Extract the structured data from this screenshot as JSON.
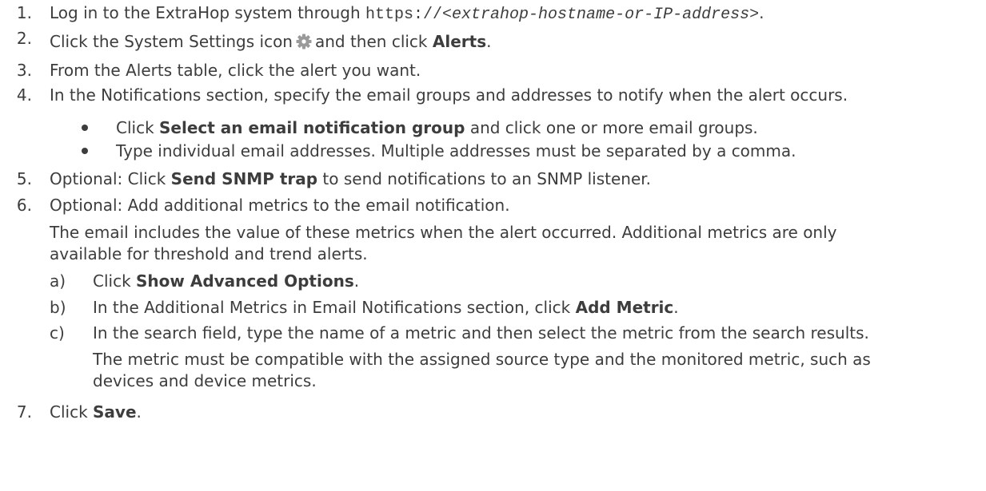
{
  "steps": [
    {
      "number": "1.",
      "a": "Log in to the ExtraHop system through ",
      "url": "https://",
      "url_var": "<extrahop-hostname-or-IP-address>",
      "b": "."
    },
    {
      "number": "2.",
      "a": "Click the System Settings icon",
      "b": "and then click ",
      "bold": "Alerts",
      "c": ".",
      "icon": "gear-icon"
    },
    {
      "number": "3.",
      "a": "From the Alerts table, click the alert you want."
    },
    {
      "number": "4.",
      "a": "In the Notifications section, specify the email groups and addresses to notify when the alert occurs."
    },
    {
      "number": "5.",
      "a": "Optional: Click ",
      "bold": "Send SNMP trap",
      "b": " to send notifications to an SNMP listener."
    },
    {
      "number": "6.",
      "a": "Optional: Add additional metrics to the email notification."
    },
    {
      "number": "7.",
      "a": "Click ",
      "bold": "Save",
      "b": "."
    }
  ],
  "bullets": [
    {
      "a": "Click ",
      "bold": "Select an email notification group",
      "b": " and click one or more email groups."
    },
    {
      "a": "Type individual email addresses. Multiple addresses must be separated by a comma."
    }
  ],
  "step6_info": {
    "line1": "The email includes the value of these metrics when the alert occurred. Additional metrics are only",
    "line2": "available for threshold and trend alerts."
  },
  "substeps": [
    {
      "label": "a)",
      "a": "Click ",
      "bold": "Show Advanced Options",
      "b": "."
    },
    {
      "label": "b)",
      "a": "In the Additional Metrics in Email Notifications section, click ",
      "bold": "Add Metric",
      "b": "."
    },
    {
      "label": "c)",
      "a": "In the search field, type the name of a metric and then select the metric from the search results."
    }
  ],
  "substep_c_info": {
    "line1": "The metric must be compatible with the assigned source type and the monitored metric, such as",
    "line2": "devices and device metrics."
  }
}
